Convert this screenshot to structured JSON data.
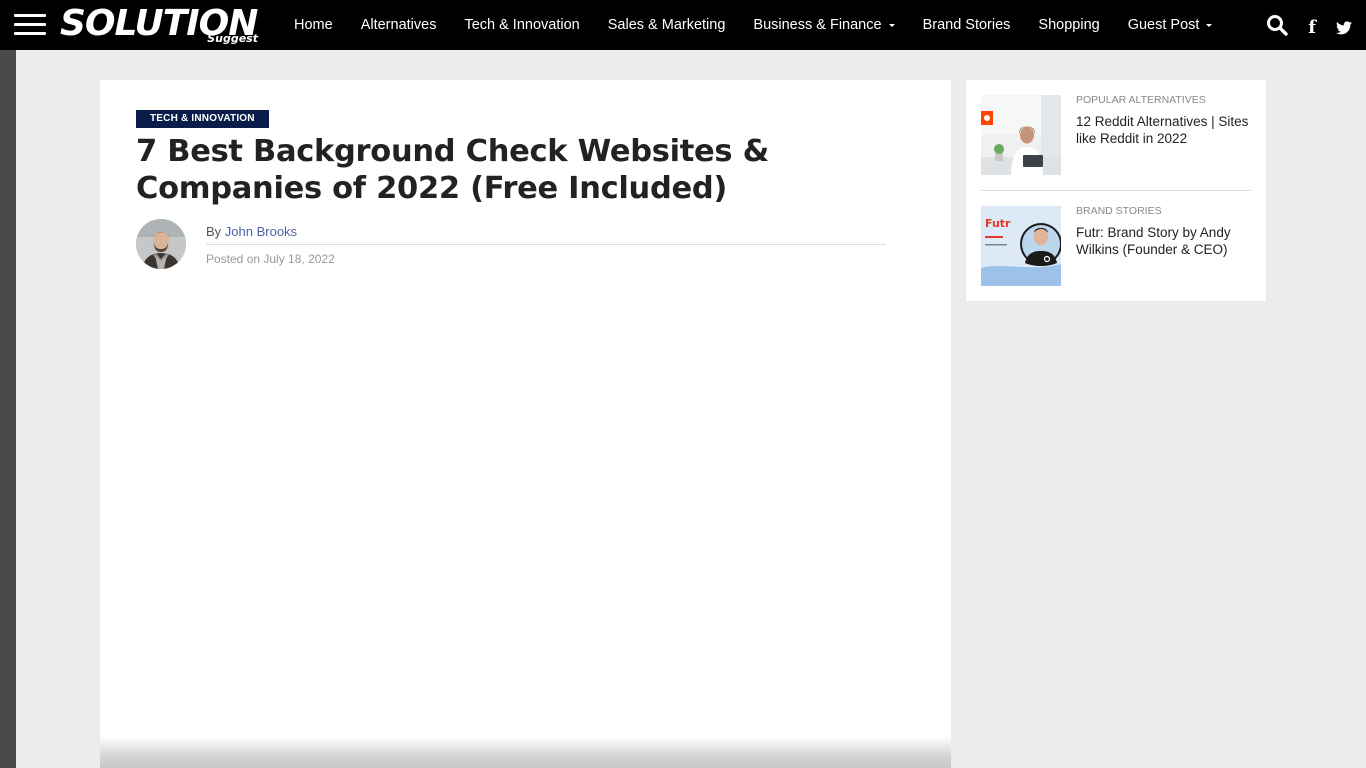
{
  "site": {
    "logo_main": "SOLUTION",
    "logo_sub": "Suggest"
  },
  "nav": {
    "items": [
      {
        "label": "Home",
        "dropdown": false
      },
      {
        "label": "Alternatives",
        "dropdown": false
      },
      {
        "label": "Tech & Innovation",
        "dropdown": false
      },
      {
        "label": "Sales & Marketing",
        "dropdown": false
      },
      {
        "label": "Business & Finance",
        "dropdown": true
      },
      {
        "label": "Brand Stories",
        "dropdown": false
      },
      {
        "label": "Shopping",
        "dropdown": false
      },
      {
        "label": "Guest Post",
        "dropdown": true
      }
    ],
    "icons": [
      "search-icon",
      "facebook-icon",
      "twitter-icon"
    ]
  },
  "article": {
    "category": "TECH & INNOVATION",
    "title": "7 Best Background Check Websites & Companies of 2022 (Free Included)",
    "by_label": "By",
    "author": "John Brooks",
    "posted": "Posted on July 18, 2022"
  },
  "sidebar": {
    "items": [
      {
        "category": "POPULAR ALTERNATIVES",
        "title": "12 Reddit Alternatives | Sites like Reddit in 2022"
      },
      {
        "category": "BRAND STORIES",
        "title": "Futr: Brand Story by Andy Wilkins (Founder & CEO)",
        "thumb_text": "Futr"
      }
    ]
  },
  "colors": {
    "nav_bg": "#000000",
    "badge_bg": "#0a1d4a",
    "author_link": "#4e5fa8",
    "page_bg": "#ececec"
  }
}
